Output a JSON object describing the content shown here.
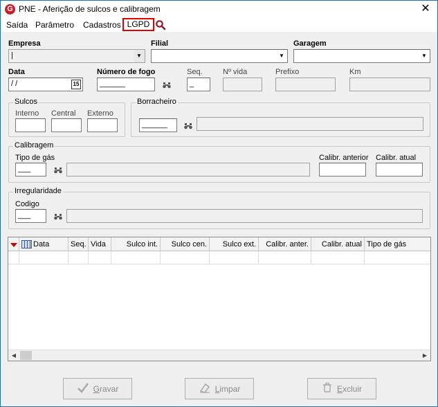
{
  "window": {
    "title": "PNE - Aferição de sulcos e calibragem",
    "close_glyph": "✕",
    "app_icon_letter": "G"
  },
  "menu": {
    "items": [
      "Saída",
      "Parâmetro",
      "Cadastros"
    ],
    "lgpd": "LGPD"
  },
  "labels": {
    "empresa": "Empresa",
    "filial": "Filial",
    "garagem": "Garagem",
    "data": "Data",
    "numero_fogo": "Número de fogo",
    "seq": "Seq.",
    "n_vida": "Nº vida",
    "prefixo": "Prefixo",
    "km": "Km"
  },
  "fields": {
    "data_value": " / /",
    "numero_fogo_value": "______",
    "seq_value": "_",
    "borracheiro_value": "______",
    "tipo_gas_value": "___",
    "codigo_value": "___",
    "calendar_label": "15"
  },
  "groups": {
    "sulcos": {
      "title": "Sulcos",
      "interno": "Interno",
      "central": "Central",
      "externo": "Externo"
    },
    "borracheiro": {
      "title": "Borracheiro"
    },
    "calibragem": {
      "title": "Calibragem",
      "tipo_gas": "Tipo de gás",
      "calibr_anterior": "Calibr. anterior",
      "calibr_atual": "Calibr. atual"
    },
    "irregularidade": {
      "title": "Irregularidade",
      "codigo": "Codigo"
    }
  },
  "grid": {
    "columns": [
      "Data",
      "Seq.",
      "Vida",
      "Sulco int.",
      "Sulco cen.",
      "Sulco ext.",
      "Calibr. anter.",
      "Calibr. atual",
      "Tipo de gás"
    ]
  },
  "buttons": {
    "gravar_u": "G",
    "gravar_rest": "ravar",
    "limpar_u": "L",
    "limpar_rest": "impar",
    "excluir_u": "E",
    "excluir_rest": "xcluir"
  },
  "colors": {
    "accent_border": "#e00000",
    "window_border": "#1c6fb5",
    "icon_red": "#c8202a"
  }
}
